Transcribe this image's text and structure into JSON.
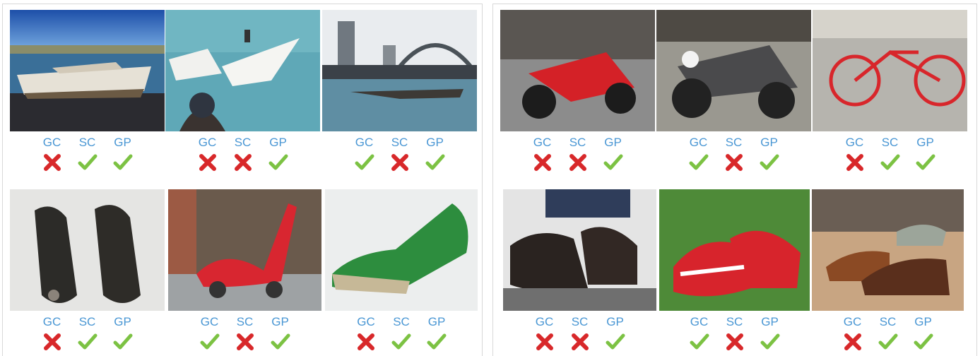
{
  "metric_labels": [
    "GC",
    "SC",
    "GP"
  ],
  "icons": {
    "pass": "check-icon",
    "fail": "cross-icon"
  },
  "colors": {
    "label": "#4a97d4",
    "check": "#7cc243",
    "cross": "#d8282a"
  },
  "panels": [
    {
      "name": "left",
      "rows": [
        [
          {
            "subject": "boat",
            "results": [
              "fail",
              "pass",
              "pass"
            ]
          },
          {
            "subject": "boat",
            "results": [
              "fail",
              "fail",
              "pass"
            ]
          },
          {
            "subject": "boat",
            "results": [
              "pass",
              "fail",
              "pass"
            ]
          }
        ],
        [
          {
            "subject": "shoe",
            "results": [
              "fail",
              "pass",
              "pass"
            ]
          },
          {
            "subject": "shoe",
            "results": [
              "pass",
              "fail",
              "pass"
            ]
          },
          {
            "subject": "shoe",
            "results": [
              "fail",
              "pass",
              "pass"
            ]
          }
        ]
      ]
    },
    {
      "name": "right",
      "rows": [
        [
          {
            "subject": "motorcycle",
            "results": [
              "fail",
              "fail",
              "pass"
            ]
          },
          {
            "subject": "motorcycle",
            "results": [
              "pass",
              "fail",
              "pass"
            ]
          },
          {
            "subject": "bicycle",
            "results": [
              "fail",
              "pass",
              "pass"
            ]
          }
        ],
        [
          {
            "subject": "shoe",
            "results": [
              "fail",
              "fail",
              "pass"
            ]
          },
          {
            "subject": "shoe",
            "results": [
              "pass",
              "fail",
              "pass"
            ]
          },
          {
            "subject": "shoe",
            "results": [
              "fail",
              "pass",
              "pass"
            ]
          }
        ]
      ]
    }
  ]
}
